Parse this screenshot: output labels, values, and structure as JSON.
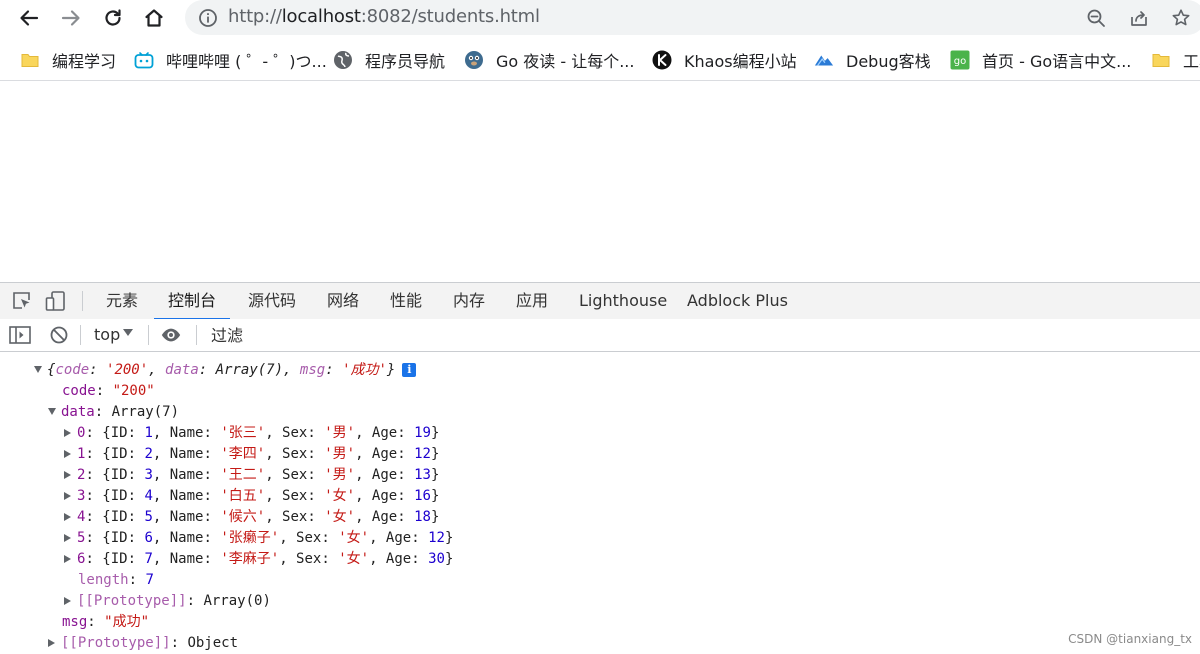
{
  "browser": {
    "url_scheme": "http://",
    "url_host": "localhost",
    "url_path": ":8082/students.html"
  },
  "bookmarks": [
    {
      "label": "编程学习",
      "icon": "folder-icon"
    },
    {
      "label": "哔哩哔哩 ( ゜- ゜)つ...",
      "icon": "bilibili-icon"
    },
    {
      "label": "程序员导航",
      "icon": "globe-icon"
    },
    {
      "label": "Go 夜读 - 让每个...",
      "icon": "gopher-icon"
    },
    {
      "label": "Khaos编程小站",
      "icon": "khaos-icon"
    },
    {
      "label": "Debug客栈",
      "icon": "debug-icon"
    },
    {
      "label": "首页 - Go语言中文...",
      "icon": "go-icon"
    },
    {
      "label": "工具",
      "icon": "folder-icon"
    }
  ],
  "devtools": {
    "tabs": [
      "元素",
      "控制台",
      "源代码",
      "网络",
      "性能",
      "内存",
      "应用",
      "Lighthouse",
      "Adblock Plus"
    ],
    "active_tab": "控制台",
    "context": "top",
    "filter_placeholder": "过滤"
  },
  "console": {
    "summary": {
      "code": "'200'",
      "data": "Array(7)",
      "msg": "'成功'"
    },
    "code_value": "\"200\"",
    "data_type": "Array(7)",
    "students": [
      {
        "index": "0",
        "ID": "1",
        "Name": "'张三'",
        "Sex": "'男'",
        "Age": "19"
      },
      {
        "index": "1",
        "ID": "2",
        "Name": "'李四'",
        "Sex": "'男'",
        "Age": "12"
      },
      {
        "index": "2",
        "ID": "3",
        "Name": "'王二'",
        "Sex": "'男'",
        "Age": "13"
      },
      {
        "index": "3",
        "ID": "4",
        "Name": "'白五'",
        "Sex": "'女'",
        "Age": "16"
      },
      {
        "index": "4",
        "ID": "5",
        "Name": "'候六'",
        "Sex": "'女'",
        "Age": "18"
      },
      {
        "index": "5",
        "ID": "6",
        "Name": "'张癞子'",
        "Sex": "'女'",
        "Age": "12"
      },
      {
        "index": "6",
        "ID": "7",
        "Name": "'李麻子'",
        "Sex": "'女'",
        "Age": "30"
      }
    ],
    "length_value": "7",
    "array_prototype": "Array(0)",
    "msg_value": "\"成功\"",
    "object_prototype": "Object"
  },
  "watermark": "CSDN @tianxiang_tx"
}
